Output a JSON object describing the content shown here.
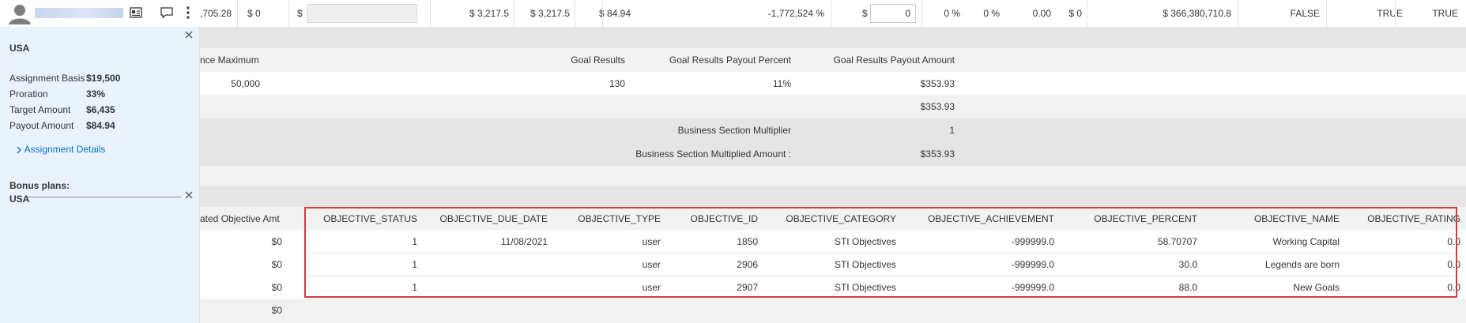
{
  "top_row": {
    "partial_amount": ",705.28",
    "zero_1": "$ 0",
    "currency_1": "$",
    "amount_a": "$ 3,217.5",
    "amount_b": "$ 3,217.5",
    "amount_c": "$ 84.94",
    "percent_big": "-1,772,524 %",
    "currency_2": "$",
    "input_value": "0",
    "pct_1": "0 %",
    "pct_2": "0 %",
    "decimal": "0.00",
    "zero_2": "$ 0",
    "big_amount": "$ 366,380,710.8",
    "flag_1": "FALSE",
    "flag_2": "TRUE",
    "flag_3": "TRUE"
  },
  "panel": {
    "country": "USA",
    "rows": [
      {
        "label": "Assignment Basis",
        "value": "$19,500"
      },
      {
        "label": "Proration",
        "value": "33%"
      },
      {
        "label": "Target Amount",
        "value": "$6,435"
      },
      {
        "label": "Payout Amount",
        "value": "$84.94"
      }
    ],
    "details_link": "Assignment Details",
    "bonus_plans_label": "Bonus plans:",
    "bonus_plans_value": "USA"
  },
  "goal_section": {
    "headers": [
      "nce Maximum",
      "Goal Results",
      "Goal Results Payout Percent",
      "Goal Results Payout Amount"
    ],
    "row": [
      "50,000",
      "130",
      "11%",
      "$353.93"
    ],
    "subtotal": "$353.93",
    "multiplier_label": "Business Section Multiplier",
    "multiplier_value": "1",
    "multiplied_label": "Business Section Multiplied Amount :",
    "multiplied_value": "$353.93"
  },
  "objectives": {
    "left_header": "ated Objective Amt",
    "headers": [
      "OBJECTIVE_STATUS",
      "OBJECTIVE_DUE_DATE",
      "OBJECTIVE_TYPE",
      "OBJECTIVE_ID",
      "OBJECTIVE_CATEGORY",
      "OBJECTIVE_ACHIEVEMENT",
      "OBJECTIVE_PERCENT",
      "OBJECTIVE_NAME",
      "OBJECTIVE_RATING"
    ],
    "rows": [
      {
        "amt": "$0",
        "cells": [
          "1",
          "11/08/2021",
          "user",
          "1850",
          "STI Objectives",
          "-999999.0",
          "58.70707",
          "Working Capital",
          "0.0"
        ]
      },
      {
        "amt": "$0",
        "cells": [
          "1",
          "",
          "user",
          "2906",
          "STI Objectives",
          "-999999.0",
          "30.0",
          "Legends are born",
          "0.0"
        ]
      },
      {
        "amt": "$0",
        "cells": [
          "1",
          "",
          "user",
          "2907",
          "STI Objectives",
          "-999999.0",
          "88.0",
          "New Goals",
          "0.0"
        ]
      }
    ],
    "total": "$0"
  },
  "colors": {
    "highlight_border": "#d6393a",
    "link": "#0a6ed1",
    "panel_bg": "#eaf3fb"
  }
}
